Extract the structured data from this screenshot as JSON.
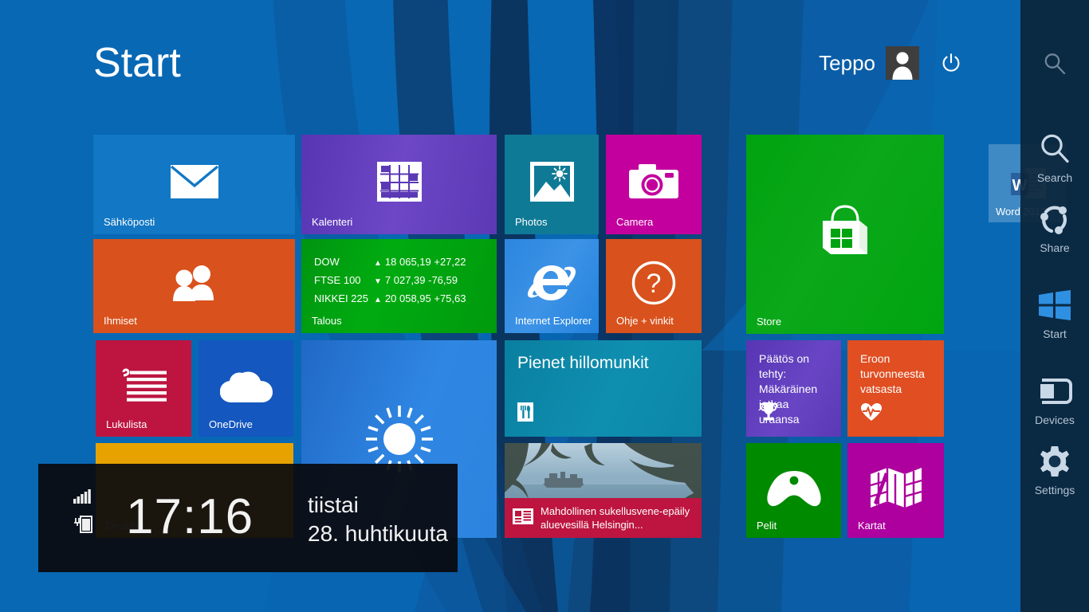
{
  "header": {
    "start_title": "Start",
    "user_name": "Teppo",
    "avatar_icon": "user-avatar-icon",
    "power_icon": "power-icon"
  },
  "colors": {
    "background": "#0868b4",
    "mail": "#1277c4",
    "calendar": "#5b39b5",
    "photos": "#0f7a96",
    "camera": "#c3009d",
    "people": "#d9511c",
    "finance": "#00a410",
    "ie": "#2989e0",
    "help": "#d9511c",
    "store": "#00a410",
    "reading_list": "#bd1540",
    "onedrive": "#1457bf",
    "weather": "#2b7fdb",
    "desktop": "#e8a200",
    "food": "#0b84a5",
    "news_caption": "#bd1540",
    "sports": "#5b39b5",
    "health": "#e04e22",
    "games": "#008a00",
    "maps": "#ad009e",
    "charms_bg": "#0b253a"
  },
  "tiles": [
    {
      "id": "mail",
      "label": "Sähköposti",
      "icon": "mail-icon"
    },
    {
      "id": "calendar",
      "label": "Kalenteri",
      "icon": "calendar-icon"
    },
    {
      "id": "photos",
      "label": "Photos",
      "icon": "photos-icon"
    },
    {
      "id": "camera",
      "label": "Camera",
      "icon": "camera-icon"
    },
    {
      "id": "store",
      "label": "Store",
      "icon": "store-bag-icon"
    },
    {
      "id": "people",
      "label": "Ihmiset",
      "icon": "people-icon"
    },
    {
      "id": "finance",
      "label": "Talous",
      "icon": "finance-icon"
    },
    {
      "id": "ie",
      "label": "Internet Explorer",
      "icon": "internet-explorer-icon"
    },
    {
      "id": "help",
      "label": "Ohje + vinkit",
      "icon": "question-mark-icon"
    },
    {
      "id": "readinglist",
      "label": "Lukulista",
      "icon": "reading-list-icon"
    },
    {
      "id": "onedrive",
      "label": "OneDrive",
      "icon": "cloud-icon"
    },
    {
      "id": "weather",
      "label": "",
      "icon": "sun-icon"
    },
    {
      "id": "desktop",
      "label": "Desktop",
      "icon": "desktop-icon"
    },
    {
      "id": "games",
      "label": "Pelit",
      "icon": "gamepad-icon"
    },
    {
      "id": "maps",
      "label": "Kartat",
      "icon": "map-icon"
    }
  ],
  "finance": {
    "label": "Talous",
    "rows": [
      {
        "name": "DOW",
        "direction": "up",
        "value": "18 065,19 +27,22"
      },
      {
        "name": "FTSE 100",
        "direction": "down",
        "value": "7 027,39 -76,59"
      },
      {
        "name": "NIKKEI 225",
        "direction": "up",
        "value": "20 058,95 +75,63"
      }
    ]
  },
  "food_tile": {
    "headline": "Pienet hillomunkit",
    "icon": "fork-knife-icon"
  },
  "news_tile": {
    "caption": "Mahdollinen sukellusvene-epäily aluevesillä Helsingin...",
    "icon": "newspaper-icon"
  },
  "sports_tile": {
    "headline": "Päätös on tehty: Mäkäräinen jatkaa uraansa",
    "icon": "trophy-icon"
  },
  "health_tile": {
    "headline": "Eroon turvonneesta vatsasta",
    "icon": "heart-pulse-icon"
  },
  "clock": {
    "time": "17:16",
    "weekday": "tiistai",
    "date": "28. huhtikuuta",
    "signal_icon": "signal-bars-icon",
    "battery_icon": "battery-charging-icon"
  },
  "charms": {
    "top_search_icon": "search-icon",
    "items": [
      {
        "label": "Search",
        "icon": "search-icon"
      },
      {
        "label": "Share",
        "icon": "share-icon"
      },
      {
        "label": "Start",
        "icon": "windows-logo-icon"
      },
      {
        "label": "Devices",
        "icon": "devices-icon"
      },
      {
        "label": "Settings",
        "icon": "gear-icon"
      }
    ]
  },
  "ghost_tile": {
    "label": "Word 2013",
    "icon": "word-icon"
  }
}
